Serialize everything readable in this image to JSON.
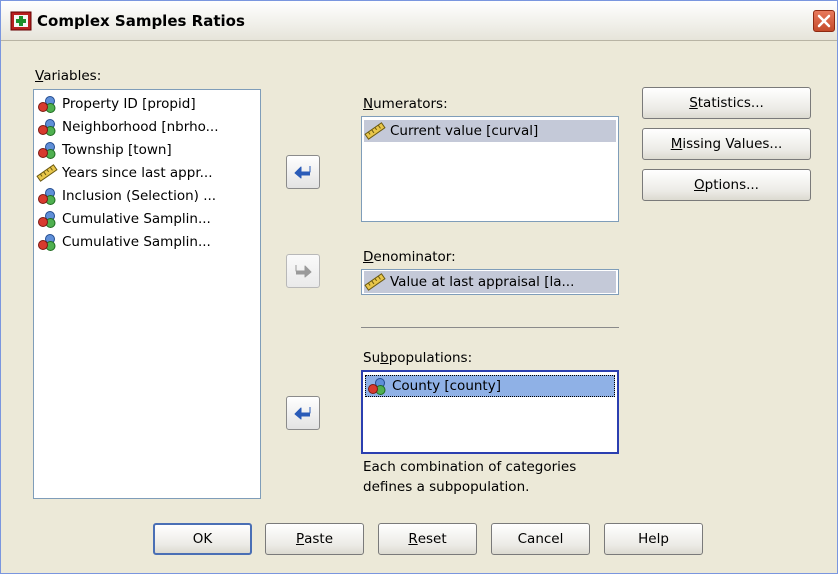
{
  "window": {
    "title": "Complex Samples Ratios"
  },
  "variables": {
    "label_ul": "V",
    "label_rest": "ariables:",
    "items": [
      {
        "label": "Property ID [propid]",
        "icon": "nominal-icon"
      },
      {
        "label": "Neighborhood [nbrho...",
        "icon": "nominal-icon"
      },
      {
        "label": "Township [town]",
        "icon": "nominal-icon"
      },
      {
        "label": "Years since last appr...",
        "icon": "scale-icon"
      },
      {
        "label": "Inclusion (Selection) ...",
        "icon": "nominal-icon"
      },
      {
        "label": "Cumulative Samplin...",
        "icon": "nominal-icon"
      },
      {
        "label": "Cumulative Samplin...",
        "icon": "nominal-icon"
      }
    ]
  },
  "numerators": {
    "label_ul": "N",
    "label_rest": "umerators:",
    "items": [
      {
        "label": "Current value [curval]",
        "icon": "scale-icon"
      }
    ]
  },
  "denominator": {
    "label_ul": "D",
    "label_rest": "enominator:",
    "value": "Value at last appraisal [la..."
  },
  "subpopulations": {
    "label_pre": "Su",
    "label_ul": "b",
    "label_rest": "populations:",
    "items": [
      {
        "label": "County [county]",
        "icon": "nominal-icon"
      }
    ],
    "note_line1": "Each combination of categories",
    "note_line2": "defines a subpopulation."
  },
  "side_buttons": {
    "statistics": {
      "ul": "S",
      "rest": "tatistics..."
    },
    "missing": {
      "pre": "",
      "ul": "M",
      "rest": "issing Values..."
    },
    "options": {
      "ul": "O",
      "rest": "ptions..."
    }
  },
  "bottom_buttons": {
    "ok": "OK",
    "paste_ul": "P",
    "paste_rest": "aste",
    "reset_ul": "R",
    "reset_rest": "eset",
    "cancel": "Cancel",
    "help": "Help"
  },
  "colors": {
    "dialog_bg": "#ece9d8",
    "selection": "#c4c9d8",
    "focus_selection": "#8fb1e6",
    "arrow_blue": "#2a5bb8"
  }
}
